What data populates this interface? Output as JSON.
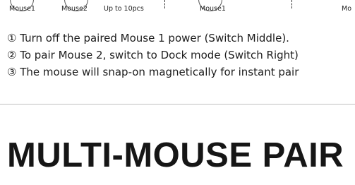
{
  "diagram": {
    "labels": [
      "Mouse1",
      "Mouse2",
      "Up to 10pcs",
      "Mouse1",
      "Mo"
    ]
  },
  "steps": [
    "① Turn off the paired Mouse 1 power (Switch Middle).",
    "② To pair Mouse 2, switch to Dock mode (Switch Right)",
    "③ The mouse will snap-on magnetically for instant pair"
  ],
  "heading": "MULTI-MOUSE PAIR"
}
